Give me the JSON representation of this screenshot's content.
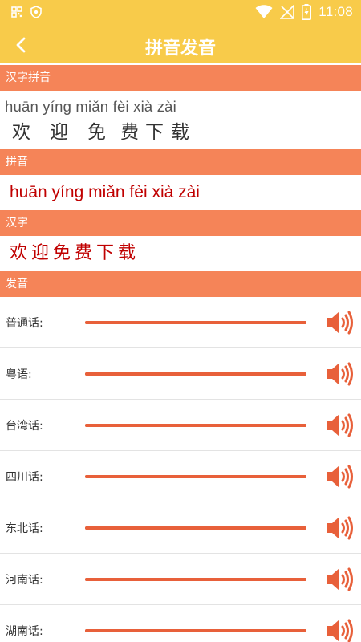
{
  "status_bar": {
    "time": "11:08",
    "left_icons": [
      "grid-icon",
      "shield-icon"
    ],
    "right_icons": [
      "wifi-icon",
      "no-signal-icon",
      "battery-charging-icon"
    ]
  },
  "app_bar": {
    "title": "拼音发音",
    "back_icon": "chevron-left-icon"
  },
  "sections": {
    "hanzi_pinyin_header": "汉字拼音",
    "pinyin_header": "拼音",
    "hanzi_header": "汉字",
    "pronunciation_header": "发音"
  },
  "ruby": {
    "pinyin_line": "huān yíng miǎn fèi xià zài",
    "characters": [
      "欢",
      "迎",
      "免",
      "费",
      "下",
      "载"
    ]
  },
  "pinyin_text": "huān yíng miǎn fèi xià zài",
  "hanzi_text": "欢迎免费下载",
  "dialects": [
    {
      "label": "普通话:",
      "progress": 1.0
    },
    {
      "label": "粤语:",
      "progress": 1.0
    },
    {
      "label": "台湾话:",
      "progress": 1.0
    },
    {
      "label": "四川话:",
      "progress": 1.0
    },
    {
      "label": "东北话:",
      "progress": 1.0
    },
    {
      "label": "河南话:",
      "progress": 1.0
    },
    {
      "label": "湖南话:",
      "progress": 1.0
    }
  ],
  "colors": {
    "app_bar": "#f8cb4a",
    "section_header": "#f58458",
    "accent": "#e8603a",
    "text_red": "#c00000"
  },
  "speaker_icon": "speaker-volume-icon"
}
